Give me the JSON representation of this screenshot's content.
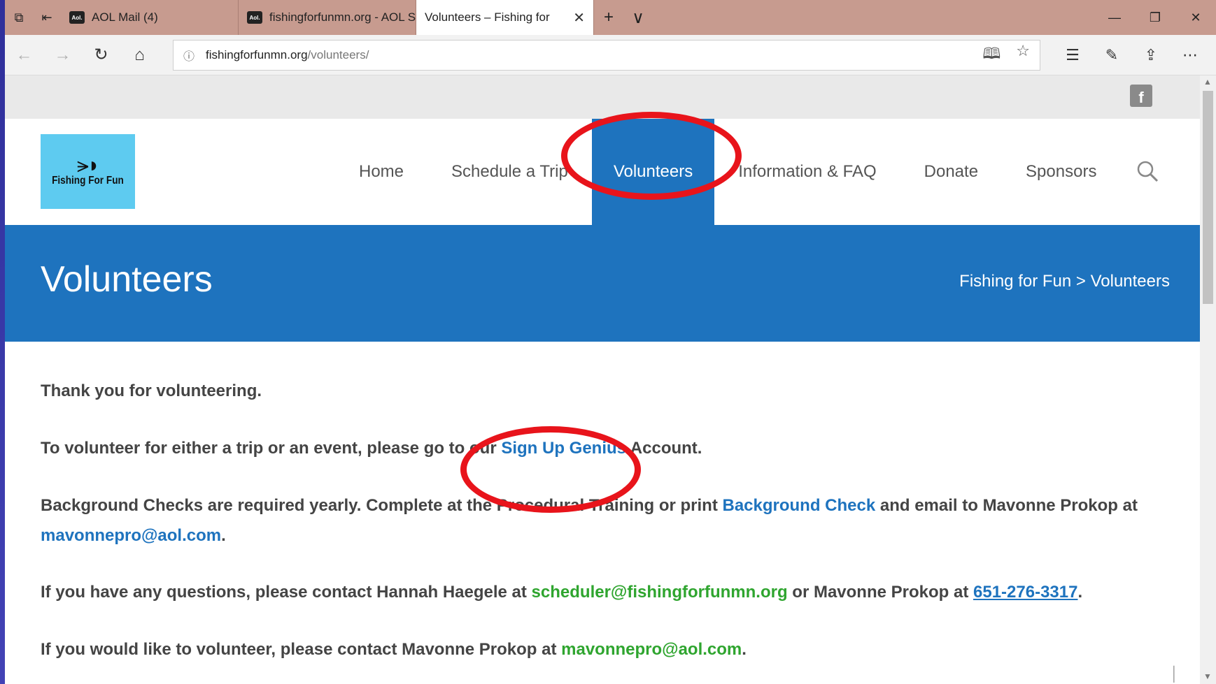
{
  "browser": {
    "tabs": [
      {
        "label": "AOL Mail (4)",
        "favicon": "Aol."
      },
      {
        "label": "fishingforfunmn.org - AOL S",
        "favicon": "Aol."
      },
      {
        "label": "Volunteers – Fishing for",
        "favicon": "page-icon"
      }
    ],
    "url_host": "fishingforfunmn.org",
    "url_path": "/volunteers/"
  },
  "site": {
    "logo_text": "Fishing For Fun",
    "nav": [
      "Home",
      "Schedule a Trip",
      "Volunteers",
      "Information & FAQ",
      "Donate",
      "Sponsors"
    ],
    "active_nav": "Volunteers",
    "page_title": "Volunteers",
    "breadcrumb": "Fishing for Fun > Volunteers"
  },
  "content": {
    "p1": "Thank you for volunteering.",
    "p2_pre": "To volunteer for either a trip or an event, please go to our ",
    "p2_link": "Sign Up Genius",
    "p2_post": " Account.",
    "p3_pre": "Background Checks are required yearly. Complete at the Procedural Training or print ",
    "p3_link": "Background Check",
    "p3_mid": " and email to Mavonne Prokop at ",
    "p3_email": "mavonnepro@aol.com",
    "p3_post": ".",
    "p4_pre": "If you have any questions, please contact Hannah Haegele at ",
    "p4_email": "scheduler@fishingforfunmn.org",
    "p4_mid": " or Mavonne Prokop at ",
    "p4_phone": "651-276-3317",
    "p4_post": ".",
    "p5_pre": "If you would like to volunteer, please contact Mavonne Prokop at ",
    "p5_email": "mavonnepro@aol.com",
    "p5_post": "."
  },
  "colors": {
    "brand_blue": "#1e73be",
    "link_green": "#2fa52f",
    "annotation_red": "#e8141b",
    "logo_bg": "#5ecbf0"
  }
}
